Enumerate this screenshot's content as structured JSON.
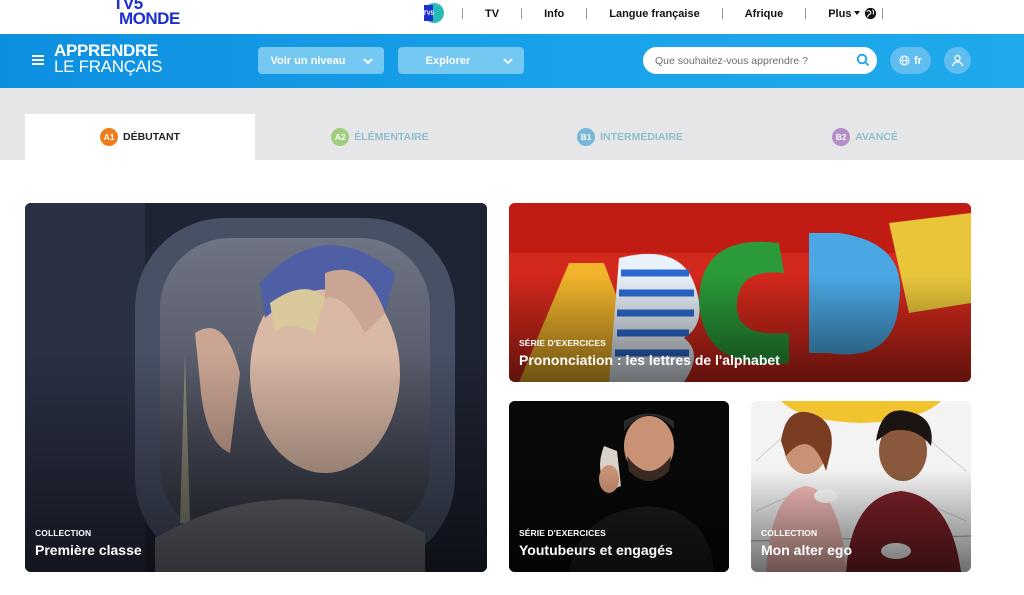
{
  "topbar": {
    "logo_line1": "TV5",
    "logo_line2": "MONDE",
    "nav": [
      "TV",
      "Info",
      "Langue française",
      "Afrique",
      "Plus"
    ]
  },
  "header": {
    "brand_line1": "APPRENDRE",
    "brand_line2": "LE FRANÇAIS",
    "level_button": "Voir un niveau",
    "explore_button": "Explorer",
    "search_placeholder": "Que souhaitez-vous apprendre ?",
    "lang": "fr",
    "accent_color": "#1aa3ea"
  },
  "levels": [
    {
      "code": "A1",
      "label": "DÉBUTANT",
      "color": "#f07d1b",
      "active": true
    },
    {
      "code": "A2",
      "label": "ÉLÉMENTAIRE",
      "color": "#9fcf7c",
      "active": false
    },
    {
      "code": "B1",
      "label": "INTERMÉDIAIRE",
      "color": "#7ab6da",
      "active": false
    },
    {
      "code": "B2",
      "label": "AVANCÉ",
      "color": "#b48ec7",
      "active": false
    }
  ],
  "cards": [
    {
      "kicker": "COLLECTION",
      "title": "Première classe",
      "image": "girl-at-airplane-window-eiffel-tower"
    },
    {
      "kicker": "SÉRIE D'EXERCICES",
      "title": "Prononciation : les lettres de l'alphabet",
      "image": "colorful-abc-letters"
    },
    {
      "kicker": "SÉRIE D'EXERCICES",
      "title": "Youtubeurs et engagés",
      "image": "man-on-phone"
    },
    {
      "kicker": "COLLECTION",
      "title": "Mon alter ego",
      "image": "couple-at-cafe"
    }
  ]
}
